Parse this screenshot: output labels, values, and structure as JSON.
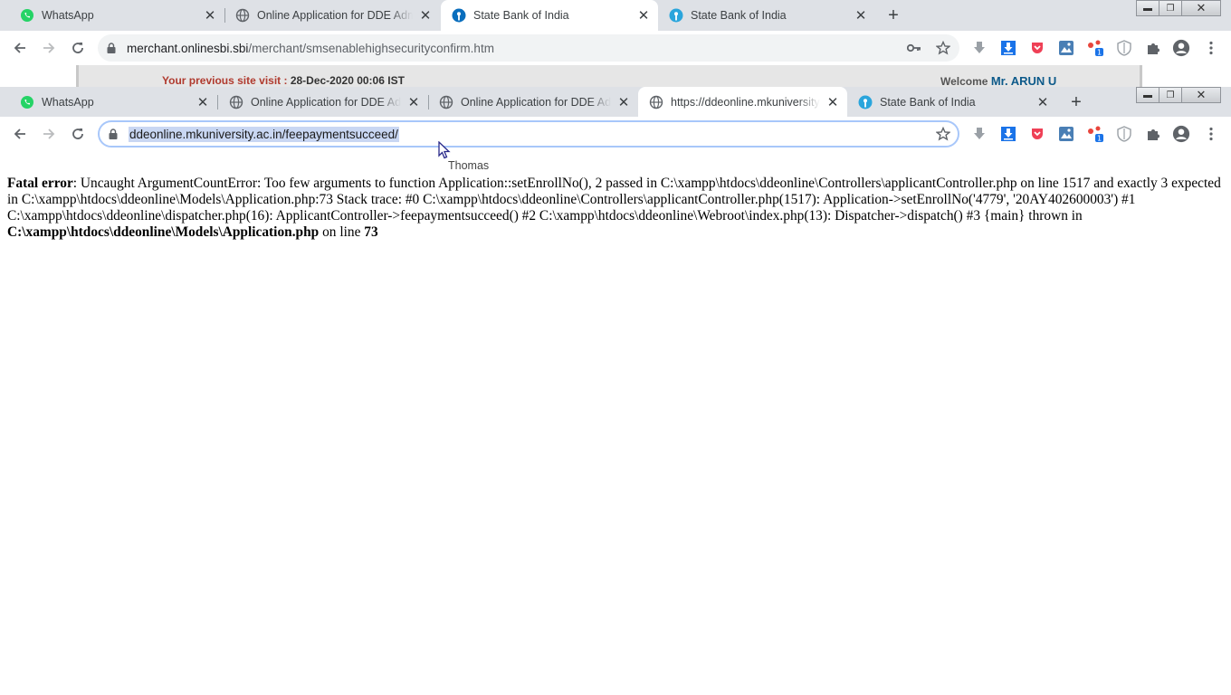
{
  "back_window": {
    "tabs": [
      {
        "title": "WhatsApp",
        "icon": "whatsapp-icon",
        "active": false
      },
      {
        "title": "Online Application for DDE Admission",
        "icon": "globe-icon",
        "active": false
      },
      {
        "title": "State Bank of India",
        "icon": "sbi-icon",
        "active": true
      },
      {
        "title": "State Bank of India",
        "icon": "sbi-icon",
        "active": false
      }
    ],
    "address": {
      "host": "merchant.onlinesbi.sbi",
      "path": "/merchant/smsenablehighsecurityconfirm.htm"
    },
    "page": {
      "visit_label": "Your previous site visit :",
      "visit_value": "28-Dec-2020 00:06 IST",
      "welcome_label": "Welcome",
      "welcome_name": "Mr. ARUN U"
    }
  },
  "front_window": {
    "tabs": [
      {
        "title": "WhatsApp",
        "icon": "whatsapp-icon",
        "active": false
      },
      {
        "title": "Online Application for DDE Admission",
        "icon": "globe-icon",
        "active": false
      },
      {
        "title": "Online Application for DDE Admission",
        "icon": "globe-icon",
        "active": false
      },
      {
        "title": "https://ddeonline.mkuniversity.ac.in/feepaymentsucceed/",
        "icon": "globe-icon",
        "active": true
      },
      {
        "title": "State Bank of India",
        "icon": "sbi-icon",
        "active": false
      }
    ],
    "address": {
      "url": "ddeonline.mkuniversity.ac.in/feepaymentsucceed/",
      "selected": true
    },
    "error": {
      "label": "Fatal error",
      "message": ": Uncaught ArgumentCountError: Too few arguments to function Application::setEnrollNo(), 2 passed in C:\\xampp\\htdocs\\ddeonline\\Controllers\\applicantController.php on line 1517 and exactly 3 expected in C:\\xampp\\htdocs\\ddeonline\\Models\\Application.php:73 Stack trace: #0 C:\\xampp\\htdocs\\ddeonline\\Controllers\\applicantController.php(1517): Application->setEnrollNo('4779', '20AY402600003') #1 C:\\xampp\\htdocs\\ddeonline\\dispatcher.php(16): ApplicantController->feepaymentsucceed() #2 C:\\xampp\\htdocs\\ddeonline\\Webroot\\index.php(13): Dispatcher->dispatch() #3 {main} thrown in",
      "file": "C:\\xampp\\htdocs\\ddeonline\\Models\\Application.php",
      "line_text": "on line",
      "line_number": "73"
    },
    "tooltip": "Thomas"
  },
  "colors": {
    "tabstrip": "#dee1e6",
    "selection": "#c9d7f3",
    "sbi_blue": "#0a6ebd",
    "extension_badge": "#1a73e8"
  }
}
